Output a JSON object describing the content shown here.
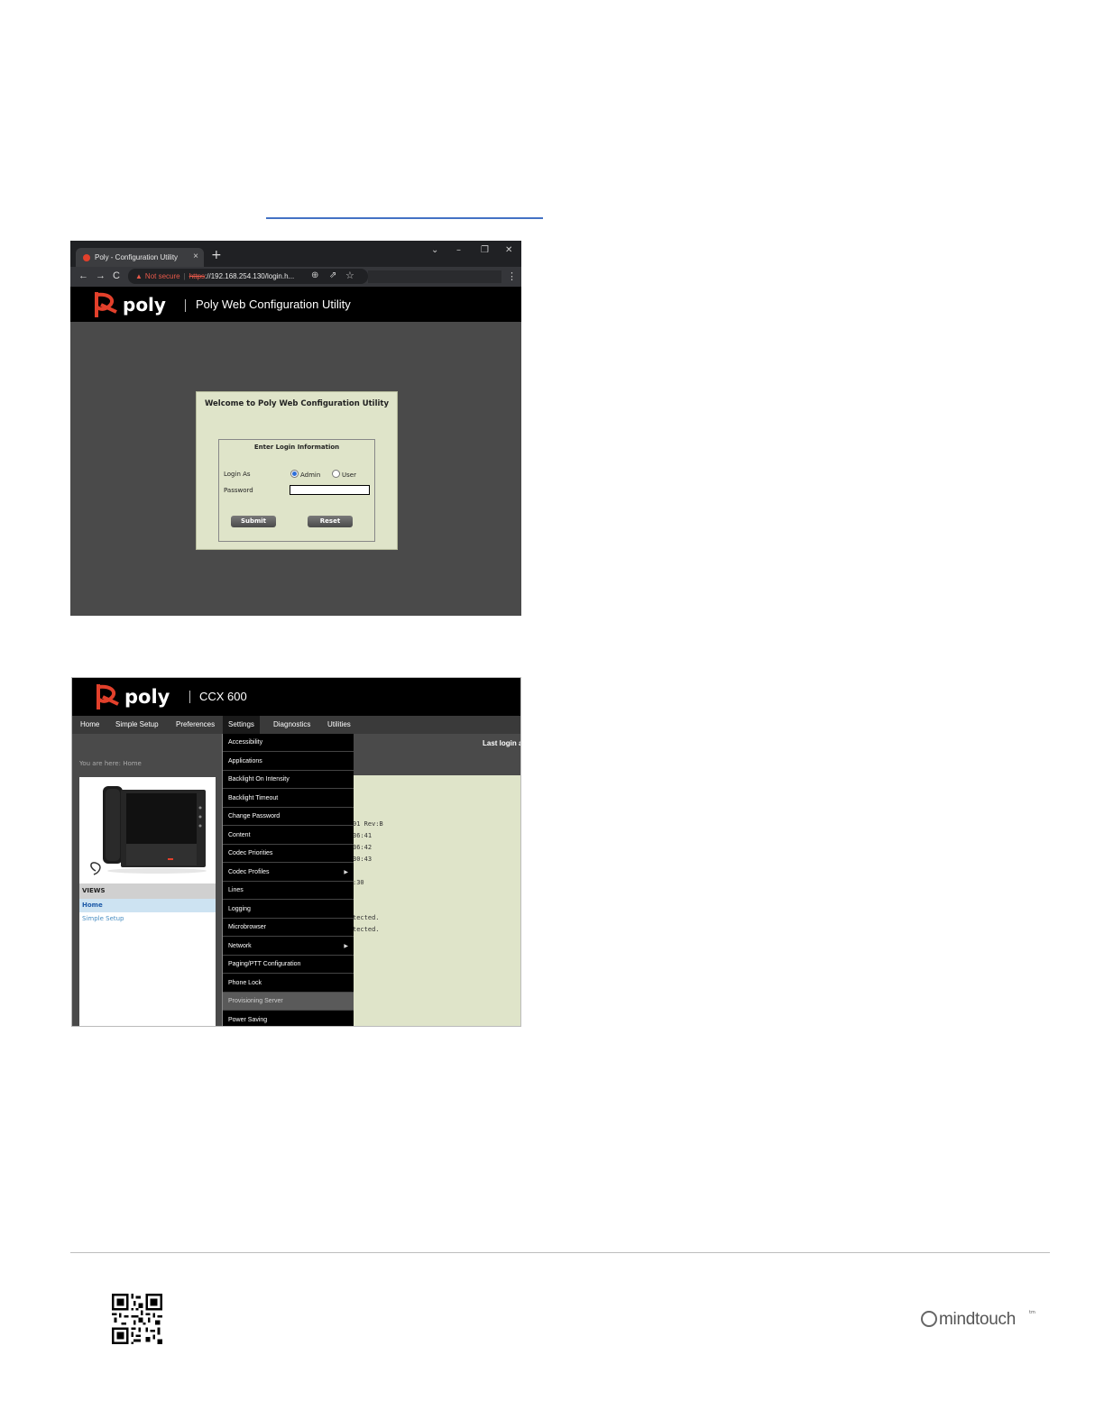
{
  "screenshot1": {
    "tab_title": "Poly - Configuration Utility",
    "tab_close": "×",
    "new_tab": "+",
    "window_controls": [
      "⌄",
      "–",
      "❐",
      "✕"
    ],
    "nav_buttons": [
      "←",
      "→",
      "C"
    ],
    "security_warning": "Not secure",
    "url_scheme": "https",
    "url_rest": "://192.168.254.130/login.h...",
    "logo_text": "poly",
    "header_title": "Poly Web Configuration Utility",
    "welcome_title": "Welcome to Poly Web Configuration Utility",
    "fieldset_title": "Enter Login Information",
    "login_as_label": "Login As",
    "radio_admin": "Admin",
    "radio_user": "User",
    "selected_role": "Admin",
    "password_label": "Password",
    "password_value": "",
    "submit_label": "Submit",
    "reset_label": "Reset"
  },
  "screenshot2": {
    "logo_text": "poly",
    "model": "CCX 600",
    "menu": [
      "Home",
      "Simple Setup",
      "Preferences",
      "Settings",
      "Diagnostics",
      "Utilities"
    ],
    "active_menu": "Settings",
    "last_login": "Last login a",
    "breadcrumb": "You are here: Home",
    "views_heading": "VIEWS",
    "views": [
      "Home",
      "Simple Setup"
    ],
    "dropdown_items": [
      {
        "label": "Accessibility",
        "submenu": false
      },
      {
        "label": "Applications",
        "submenu": false
      },
      {
        "label": "Backlight On Intensity",
        "submenu": false
      },
      {
        "label": "Backlight Timeout",
        "submenu": false
      },
      {
        "label": "Change Password",
        "submenu": false
      },
      {
        "label": "Content",
        "submenu": false
      },
      {
        "label": "Codec Priorities",
        "submenu": false
      },
      {
        "label": "Codec Profiles",
        "submenu": true
      },
      {
        "label": "Lines",
        "submenu": false
      },
      {
        "label": "Logging",
        "submenu": false
      },
      {
        "label": "Microbrowser",
        "submenu": false
      },
      {
        "label": "Network",
        "submenu": true
      },
      {
        "label": "Paging/PTT Configuration",
        "submenu": false
      },
      {
        "label": "Phone Lock",
        "submenu": false
      },
      {
        "label": "Provisioning Server",
        "submenu": false,
        "highlighted": true
      },
      {
        "label": "Power Saving",
        "submenu": false
      }
    ],
    "submenu_arrow": "▶",
    "content_fragments": [
      "01 Rev:B",
      "36:41",
      "36:42",
      "30:43",
      ":30",
      "tected.",
      "tected."
    ]
  },
  "footer": {
    "brand": "mindtouch",
    "trademark": "tm"
  },
  "colors": {
    "link_underline": "#4472c4",
    "poly_red": "#e2402b",
    "panel_green": "#dfe4c9",
    "dark_gray": "#4a4a4a"
  }
}
